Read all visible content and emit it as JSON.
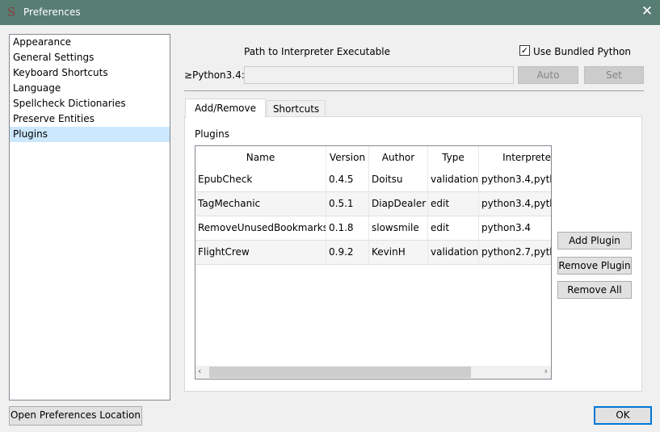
{
  "window": {
    "title": "Preferences",
    "logo": "S",
    "close": "✕"
  },
  "sidebar": {
    "items": [
      {
        "label": "Appearance"
      },
      {
        "label": "General Settings"
      },
      {
        "label": "Keyboard Shortcuts"
      },
      {
        "label": "Language"
      },
      {
        "label": "Spellcheck Dictionaries"
      },
      {
        "label": "Preserve Entities"
      },
      {
        "label": "Plugins",
        "selected": true
      }
    ]
  },
  "interpreter": {
    "path_label": "Path to Interpreter Executable",
    "use_bundled_label": "Use Bundled Python",
    "use_bundled_checked": true,
    "python_label": "≥Python3.4:",
    "path_value": "",
    "auto_label": "Auto",
    "set_label": "Set"
  },
  "tabs": [
    {
      "label": "Add/Remove",
      "active": true
    },
    {
      "label": "Shortcuts"
    }
  ],
  "plugins": {
    "label": "Plugins",
    "columns": [
      "Name",
      "Version",
      "Author",
      "Type",
      "Interprete"
    ],
    "rows": [
      [
        "EpubCheck",
        "0.4.5",
        "Doitsu",
        "validation",
        "python3.4,pyth"
      ],
      [
        "TagMechanic",
        "0.5.1",
        "DiapDealer",
        "edit",
        "python3.4,pyth"
      ],
      [
        "RemoveUnusedBookmarks",
        "0.1.8",
        "slowsmile",
        "edit",
        "python3.4"
      ],
      [
        "FlightCrew",
        "0.9.2",
        "KevinH",
        "validation",
        "python2.7,pyth"
      ]
    ],
    "add_label": "Add Plugin",
    "remove_label": "Remove Plugin",
    "remove_all_label": "Remove All"
  },
  "footer": {
    "open_location_label": "Open Preferences Location",
    "ok_label": "OK"
  }
}
